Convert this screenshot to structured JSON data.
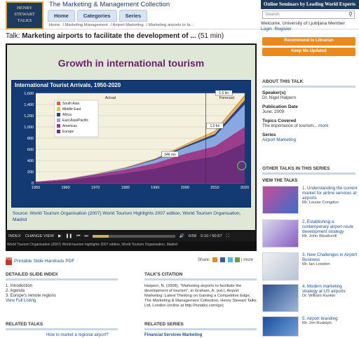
{
  "header": {
    "logo_lines": [
      "HENRY",
      "STEWART",
      "TALKS"
    ],
    "collection_title": "The Marketing & Management Collection",
    "nav": [
      "Home",
      "Categories",
      "Series"
    ],
    "breadcrumb": [
      "Home",
      "Marketing Management",
      "Airport Marketing",
      "Marketing airports to fa..."
    ],
    "promo": "Online Seminars by Leading World Experts",
    "search_placeholder": "Search"
  },
  "talk": {
    "prefix": "Talk:",
    "title": "Marketing airports to facilitate the development of ...",
    "duration": "(51 min)"
  },
  "slide": {
    "title": "Growth in international tourism",
    "source": "Source: World Tourism Organisation (2007) World Tourism Highlights 2007 edition, World Tourism Organisation, Madrid"
  },
  "chart_data": {
    "type": "area",
    "title": "International Tourist Arrivals, 1950-2020",
    "x": [
      1950,
      1960,
      1970,
      1980,
      1990,
      2000,
      2010,
      2020
    ],
    "ylim": [
      0,
      1600
    ],
    "yticks": [
      0,
      200,
      400,
      600,
      800,
      1000,
      1200,
      1400,
      1600
    ],
    "series": [
      {
        "name": "Europe",
        "values": [
          17,
          50,
          113,
          178,
          262,
          393,
          480,
          717
        ]
      },
      {
        "name": "Americas",
        "values": [
          7,
          17,
          42,
          62,
          93,
          128,
          175,
          285
        ]
      },
      {
        "name": "East Asia/Pacific",
        "values": [
          0,
          1,
          6,
          23,
          56,
          110,
          180,
          397
        ]
      },
      {
        "name": "Africa",
        "values": [
          1,
          1,
          2,
          7,
          15,
          28,
          40,
          77
        ]
      },
      {
        "name": "Middle East",
        "values": [
          0,
          1,
          2,
          7,
          10,
          24,
          45,
          69
        ]
      },
      {
        "name": "South Asia",
        "values": [
          0,
          0,
          1,
          2,
          3,
          6,
          10,
          19
        ]
      }
    ],
    "colors": [
      "#6b2d7a",
      "#9b3d8a",
      "#8aa8e0",
      "#2a3f8f",
      "#e8b84a",
      "#d95f2a"
    ],
    "annotations": [
      "Actual",
      "Forecast",
      "1.6 bn",
      "1.0 bn",
      "346 mn"
    ]
  },
  "player": {
    "index_label": "INDEX",
    "change_view_label": "CHANGE VIEW",
    "slide_counter": "6/58",
    "time": "5:10 / 50:57",
    "progress": 0.2,
    "caption": "World Tourism Organisation (2007) World tourism highlights 2007 edition, World Tourism Organisation, Madrid"
  },
  "handout": "Printable Slide Handouts PDF",
  "share_label": "Share:",
  "more_label": "more",
  "slide_index": {
    "heading": "DETAILED SLIDE INDEX",
    "items": [
      "1. Introduction",
      "2. Agenda",
      "3. Europe's remote regions"
    ],
    "link": "View Full Listing"
  },
  "citation": {
    "heading": "TALK'S CITATION",
    "text": "Halpern, N. (2008), \"Marketing airports to facilitate the development of tourism\", in Graham, A. (ed.), Airport Marketing: Latest Thinking on Gaining a Competitive Edge, The Marketing & Management Collection, Henry Stewart Talks Ltd, London (online at http://hstalks.com/go)"
  },
  "related_talks": {
    "heading": "RELATED TALKS",
    "first": "How to market a regional airport?"
  },
  "related_series": {
    "heading": "RELATED SERIES",
    "first": "Financial Services Marketing"
  },
  "sidebar": {
    "welcome": "Welcome, University of Ljubljana Member",
    "login": "Login",
    "register": "Register",
    "btn_recommend": "Recommend to Librarian",
    "btn_updated": "Keep Me Updated",
    "about_heading": "ABOUT THIS TALK",
    "speaker_label": "Speaker(s)",
    "speaker": "Dr. Nigel Halpern",
    "pub_label": "Publication Date",
    "pub_date": "June, 2009",
    "topics_label": "Topics Covered",
    "topics": "The importance of tourism...",
    "topics_more": "more",
    "series_label": "Series",
    "series": "Airport Marketing",
    "other_heading": "OTHER TALKS IN THIS SERIES",
    "view_heading": "VIEW THE TALKS",
    "talks": [
      {
        "title": "1. Understanding the current market for airline services at airports",
        "speaker": "Mr. Louise Congdon"
      },
      {
        "title": "2. Establishing a contemporary airport route development strategy",
        "speaker": "Mr. John Weatherill"
      },
      {
        "title": "3. New Challenges in Airport Business",
        "speaker": "Mr. Ian Lowden"
      },
      {
        "title": "4. Modern marketing strategy at US airports",
        "speaker": "Dr. William Rankin"
      },
      {
        "title": "5. Airport branding",
        "speaker": "Mr. Jim Rudolph"
      }
    ]
  }
}
